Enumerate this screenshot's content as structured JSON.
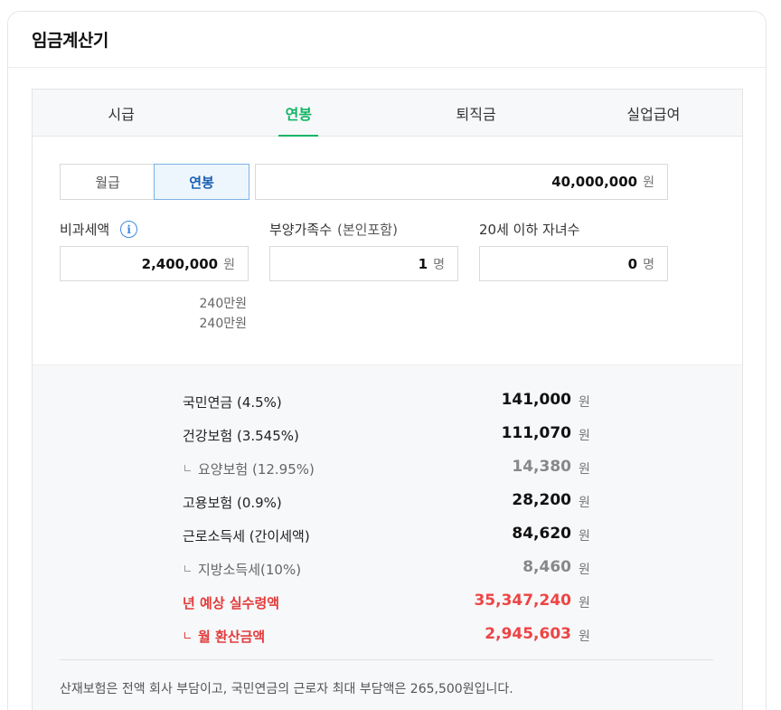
{
  "title": "임금계산기",
  "tabs": [
    {
      "label": "시급",
      "active": false
    },
    {
      "label": "연봉",
      "active": true
    },
    {
      "label": "퇴직금",
      "active": false
    },
    {
      "label": "실업급여",
      "active": false
    }
  ],
  "period_toggle": {
    "monthly": "월급",
    "annual": "연봉",
    "selected": "연봉"
  },
  "salary": {
    "value": "40,000,000",
    "unit": "원"
  },
  "nontax": {
    "label": "비과세액",
    "value": "2,400,000",
    "unit": "원",
    "hint1": "240만원",
    "hint2": "240만원"
  },
  "dependents": {
    "label": "부양가족수",
    "sub": "(본인포함)",
    "value": "1",
    "unit": "명"
  },
  "children": {
    "label": "20세 이하 자녀수",
    "value": "0",
    "unit": "명"
  },
  "results": [
    {
      "label": "국민연금 (4.5%)",
      "value": "141,000",
      "unit": "원",
      "indent": false,
      "style": "normal"
    },
    {
      "label": "건강보험 (3.545%)",
      "value": "111,070",
      "unit": "원",
      "indent": false,
      "style": "normal"
    },
    {
      "label": "요양보험 (12.95%)",
      "value": "14,380",
      "unit": "원",
      "indent": true,
      "style": "muted"
    },
    {
      "label": "고용보험 (0.9%)",
      "value": "28,200",
      "unit": "원",
      "indent": false,
      "style": "normal"
    },
    {
      "label": "근로소득세 (간이세액)",
      "value": "84,620",
      "unit": "원",
      "indent": false,
      "style": "normal"
    },
    {
      "label": "지방소득세(10%)",
      "value": "8,460",
      "unit": "원",
      "indent": true,
      "style": "muted"
    },
    {
      "label": "년 예상 실수령액",
      "value": "35,347,240",
      "unit": "원",
      "indent": false,
      "style": "red"
    },
    {
      "label": "월 환산금액",
      "value": "2,945,603",
      "unit": "원",
      "indent": true,
      "style": "red"
    }
  ],
  "note": "산재보험은 전액 회사 부담이고, 국민연금의 근로자 최대 부담액은 265,500원입니다.",
  "colors": {
    "accent_green": "#12b564",
    "toggle_blue": "#1b5fb5",
    "highlight_red": "#ee4444",
    "info_blue": "#3a8be0"
  }
}
